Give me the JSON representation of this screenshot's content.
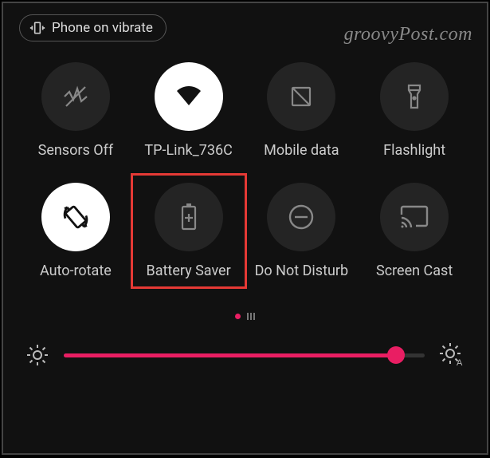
{
  "status": {
    "vibrate_label": "Phone on vibrate"
  },
  "watermark": "groovyPost.com",
  "tiles": [
    {
      "label": "Sensors Off"
    },
    {
      "label": "TP-Link_736C"
    },
    {
      "label": "Mobile data"
    },
    {
      "label": "Flashlight"
    },
    {
      "label": "Auto-rotate"
    },
    {
      "label": "Battery Saver"
    },
    {
      "label": "Do Not Disturb"
    },
    {
      "label": "Screen Cast"
    }
  ],
  "brightness": {
    "value_percent": 92
  },
  "highlighted_tile": "Battery Saver",
  "pager": {
    "current": 1,
    "total": 2
  }
}
